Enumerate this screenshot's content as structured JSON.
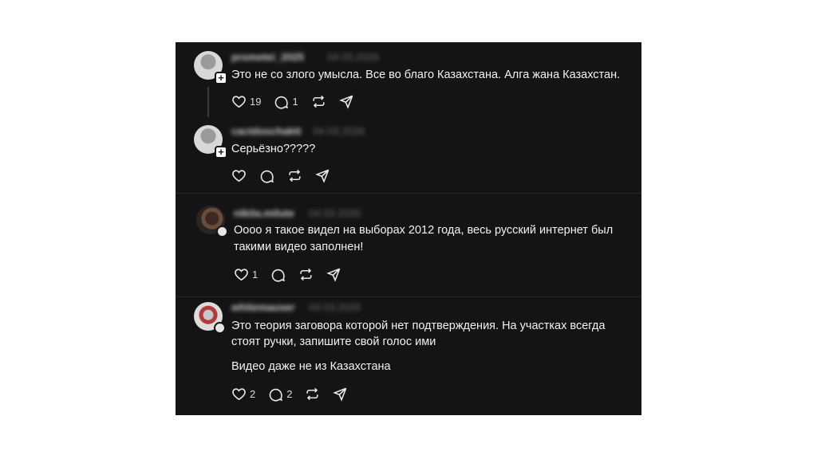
{
  "comments": [
    {
      "username": "prometei_2025",
      "date": "04.03.2026",
      "lines": [
        "Это не со злого умысла. Все во благо Казахстана. Алга жана Казахстан."
      ],
      "likes": "19",
      "replies": "1"
    },
    {
      "username": "cactdoschaktt",
      "date": "04.03.2026",
      "lines": [
        "Серьёзно?????"
      ],
      "likes": "",
      "replies": ""
    },
    {
      "username": "nikita.milute",
      "date": "04.03.2026",
      "lines": [
        "Оооо я такое видел на выборах 2012 года, весь русский интернет был",
        "такими видео заполнен!"
      ],
      "likes": "1",
      "replies": ""
    },
    {
      "username": "whitemauser",
      "date": "04.03.2026",
      "lines": [
        "Это теория заговора которой нет подтверждения. На участках всегда",
        "стоят ручки, запишите свой голос ими",
        "Видео даже не из Казахстана"
      ],
      "likes": "2",
      "replies": "2"
    }
  ],
  "icons": {
    "like": "heart-icon",
    "reply": "comment-icon",
    "repost": "repost-icon",
    "share": "share-icon",
    "follow": "plus-icon"
  },
  "colors": {
    "background": "#141414",
    "text": "#f2f2f2"
  }
}
